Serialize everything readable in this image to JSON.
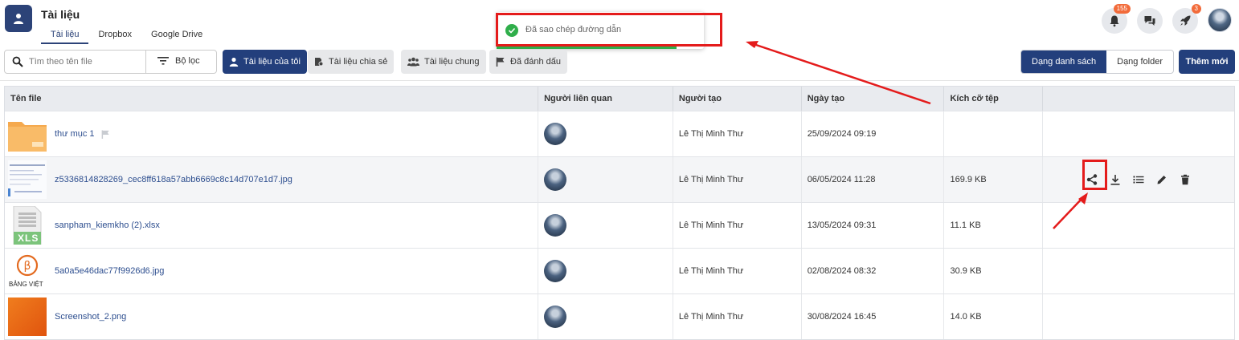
{
  "app": {
    "title": "Tài liệu"
  },
  "tabs": [
    {
      "label": "Tài liệu",
      "active": true
    },
    {
      "label": "Dropbox",
      "active": false
    },
    {
      "label": "Google Drive",
      "active": false
    }
  ],
  "header": {
    "notifications_count": "155",
    "rocket_count": "3",
    "icons": [
      "bell-icon",
      "chat-icon",
      "rocket-icon",
      "avatar"
    ]
  },
  "toast": {
    "message": "Đã sao chép đường dẫn",
    "progress": 0.87,
    "color": "#2fae4a"
  },
  "toolbar": {
    "search_placeholder": "Tìm theo tên file",
    "filter_label": "Bộ lọc",
    "chips": [
      {
        "label": "Tài liệu của tôi",
        "icon": "person-icon",
        "active": true
      },
      {
        "label": "Tài liệu chia sẻ",
        "icon": "shared-doc-icon",
        "active": false
      },
      {
        "label": "Tài liệu chung",
        "icon": "group-icon",
        "active": false
      },
      {
        "label": "Đã đánh dấu",
        "icon": "flag-icon",
        "active": false
      }
    ],
    "view_list_label": "Dạng danh sách",
    "view_folder_label": "Dạng folder",
    "add_label": "Thêm mới"
  },
  "table": {
    "columns": [
      "Tên file",
      "Người liên quan",
      "Người tạo",
      "Ngày tạo",
      "Kích cỡ tệp",
      ""
    ],
    "rows": [
      {
        "name": "thư mục 1",
        "type": "folder",
        "creator": "Lê Thị Minh Thư",
        "date": "25/09/2024 09:19",
        "size": ""
      },
      {
        "name": "z5336814828269_cec8ff618a57abb6669c8c14d707e1d7.jpg",
        "type": "image-doc",
        "creator": "Lê Thị Minh Thư",
        "date": "06/05/2024 11:28",
        "size": "169.9 KB"
      },
      {
        "name": "sanpham_kiemkho (2).xlsx",
        "type": "xls",
        "creator": "Lê Thị Minh Thư",
        "date": "13/05/2024 09:31",
        "size": "11.1 KB"
      },
      {
        "name": "5a0a5e46dac77f9926d6.jpg",
        "type": "logo",
        "logo_text": "BẢNG VIỆT",
        "creator": "Lê Thị Minh Thư",
        "date": "02/08/2024 08:32",
        "size": "30.9 KB"
      },
      {
        "name": "Screenshot_2.png",
        "type": "orange",
        "creator": "Lê Thị Minh Thư",
        "date": "30/08/2024 16:45",
        "size": "14.0 KB"
      }
    ],
    "row_actions": [
      "share-icon",
      "download-icon",
      "list-icon",
      "edit-icon",
      "delete-icon"
    ],
    "xls_label": "XLS"
  },
  "colors": {
    "primary": "#233f7c",
    "highlight": "#e41b1b",
    "success": "#2fae4a",
    "badge": "#f26b3a"
  }
}
